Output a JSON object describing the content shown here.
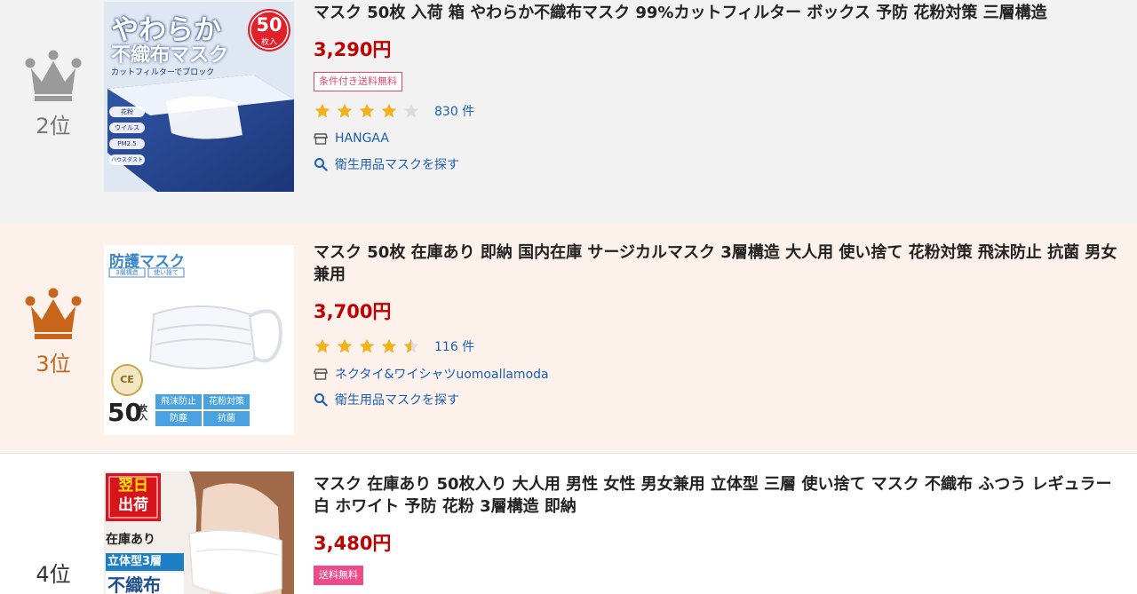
{
  "ranking": {
    "items": [
      {
        "rank_label": "2位",
        "crown_color": "#9a9a9a",
        "title": "マスク 50枚 入荷 箱 やわらか不織布マスク 99%カットフィルター ボックス 予防 花粉対策 三層構造",
        "price": "3,290円",
        "badge": "条件付き送料無料",
        "rating": 4,
        "review_count": "830 件",
        "shop": "HANGAA",
        "search_link": "衛生用品マスクを探す",
        "image": {
          "headline": "やわらか",
          "subline": "不織布マスク",
          "count_top": "50",
          "count_bottom": "枚入",
          "caption": "カットフィルターでブロック",
          "features": [
            "花粉",
            "ウイルス",
            "PM2.5",
            "ハウスダスト"
          ]
        }
      },
      {
        "rank_label": "3位",
        "crown_color": "#c8651b",
        "title": "マスク 50枚 在庫あり 即納 国内在庫 サージカルマスク 3層構造 大人用 使い捨て 花粉対策 飛沫防止 抗菌 男女兼用",
        "price": "3,700円",
        "rating": 4.5,
        "review_count": "116 件",
        "shop": "ネクタイ&ワイシャツuomoallamoda",
        "search_link": "衛生用品マスクを探す",
        "image": {
          "headline": "防護マスク",
          "tags_small": [
            "3層構造",
            "使い捨て"
          ],
          "count": "50",
          "count_unit": "枚入",
          "ce": "CE",
          "features": [
            "飛沫防止",
            "花粉対策",
            "防塵",
            "抗菌"
          ]
        }
      },
      {
        "rank_label": "4位",
        "crown_color": "",
        "title": "マスク 在庫あり 50枚入り 大人用 男性 女性 男女兼用 立体型 三層 使い捨て マスク 不織布 ふつう レギュラー 白 ホワイト 予防 花粉 3層構造 即納",
        "price": "3,480円",
        "badge": "送料無料",
        "image": {
          "red_tag_1": "翌日",
          "red_tag_2": "出荷",
          "stock": "在庫あり",
          "shape": "立体型3層",
          "bottom": "不織布"
        }
      }
    ]
  },
  "colors": {
    "price": "#bf0000",
    "link": "#1b5fb5",
    "star": "#f3b11c",
    "star_empty": "#dcdcdc",
    "row_2_bg": "#f2f2f2",
    "row_3_bg": "#fcf1eb"
  }
}
